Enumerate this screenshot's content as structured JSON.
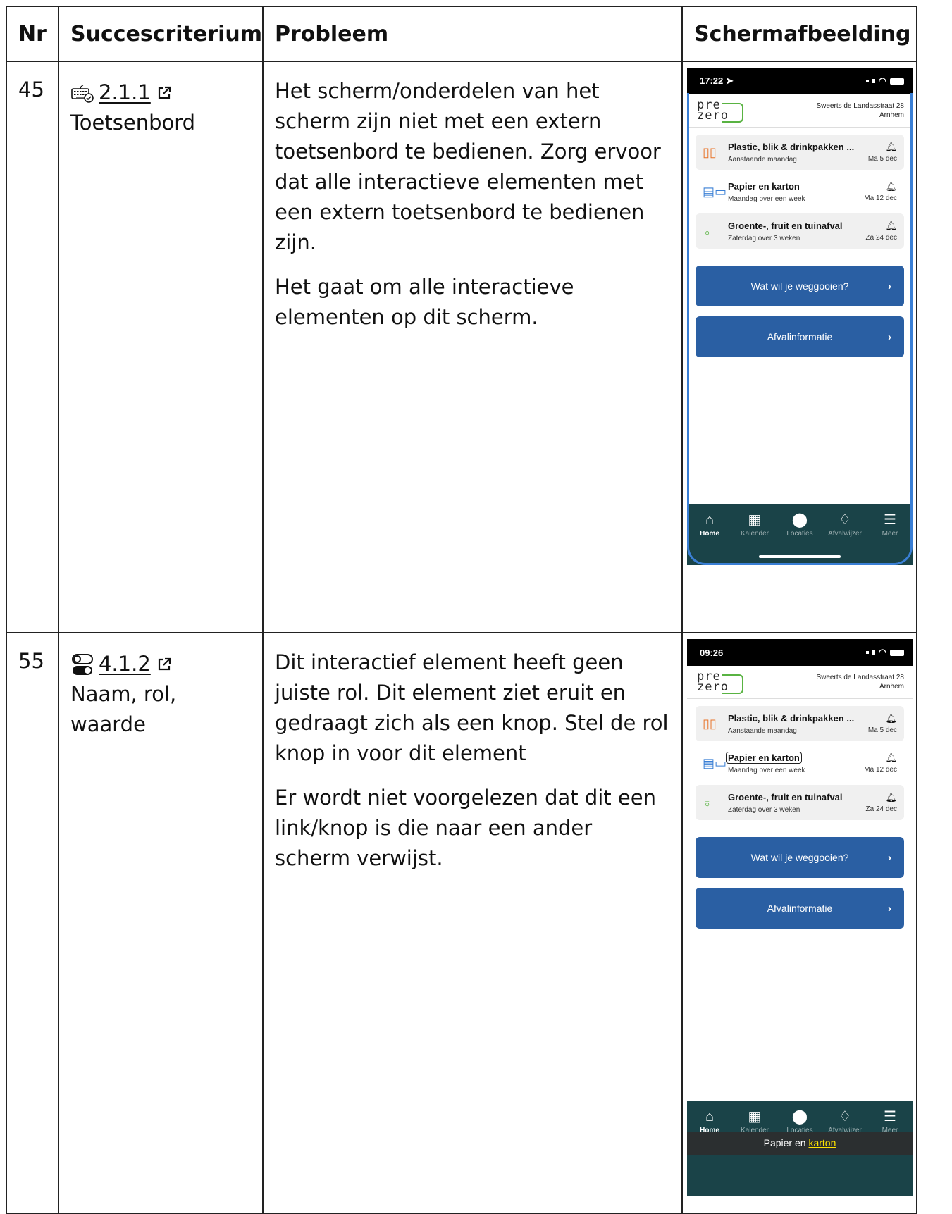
{
  "headers": {
    "nr": "Nr",
    "criterion": "Succescriterium",
    "problem": "Probleem",
    "screenshot": "Schermafbeelding"
  },
  "rows": [
    {
      "nr": "45",
      "criterion_icon": "keyboard-icon",
      "criterion_code": "2.1.1",
      "criterion_name": "Toetsenbord",
      "problem": [
        "Het scherm/onderdelen van het scherm zijn niet met een extern toetsenbord te bedienen. Zorg ervoor dat alle interactieve elementen met een extern toetsenbord te bedienen zijn.",
        "Het gaat om alle interactieve elementen op dit scherm."
      ],
      "phone": {
        "time": "17:22",
        "address_line1": "Sweerts de Landasstraat 28",
        "address_line2": "Arnhem",
        "logo_top": "pre",
        "logo_bottom": "zero",
        "pickups": [
          {
            "name": "Plastic, blik & drinkpakken ...",
            "when": "Aanstaande maandag",
            "date": "Ma 5 dec",
            "icon": "plastic-bottles-icon",
            "color": "#e8742a"
          },
          {
            "name": "Papier en karton",
            "when": "Maandag over een week",
            "date": "Ma 12 dec",
            "icon": "paper-icon",
            "color": "#3a7fd5"
          },
          {
            "name": "Groente-, fruit en tuinafval",
            "when": "Zaterdag over 3 weken",
            "date": "Za 24 dec",
            "icon": "apple-core-icon",
            "color": "#59b342"
          }
        ],
        "buttons": [
          "Wat wil je weggooien?",
          "Afvalinformatie"
        ],
        "tabs": [
          "Home",
          "Kalender",
          "Locaties",
          "Afvalwijzer",
          "Meer"
        ]
      }
    },
    {
      "nr": "55",
      "criterion_icon": "toggle-icon",
      "criterion_code": "4.1.2",
      "criterion_name": "Naam, rol, waarde",
      "problem": [
        "Dit interactief element heeft geen juiste rol. Dit element ziet eruit en gedraagt zich als een knop. Stel de rol knop in voor dit element",
        "Er wordt niet voorgelezen dat dit een link/knop is die naar een ander scherm verwijst."
      ],
      "phone": {
        "time": "09:26",
        "address_line1": "Sweerts de Landasstraat 28",
        "address_line2": "Arnhem",
        "logo_top": "pre",
        "logo_bottom": "zero",
        "pickups": [
          {
            "name": "Plastic, blik & drinkpakken ...",
            "when": "Aanstaande maandag",
            "date": "Ma 5 dec",
            "icon": "plastic-bottles-icon",
            "color": "#e8742a"
          },
          {
            "name": "Papier en karton",
            "when": "Maandag over een week",
            "date": "Ma 12 dec",
            "icon": "paper-icon",
            "color": "#3a7fd5"
          },
          {
            "name": "Groente-, fruit en tuinafval",
            "when": "Zaterdag over 3 weken",
            "date": "Za 24 dec",
            "icon": "apple-core-icon",
            "color": "#59b342"
          }
        ],
        "buttons": [
          "Wat wil je weggooien?",
          "Afvalinformatie"
        ],
        "tabs": [
          "Home",
          "Kalender",
          "Locaties",
          "Afvalwijzer",
          "Meer"
        ],
        "caption_prefix": "Papier en",
        "caption_highlight": "karton"
      }
    }
  ]
}
